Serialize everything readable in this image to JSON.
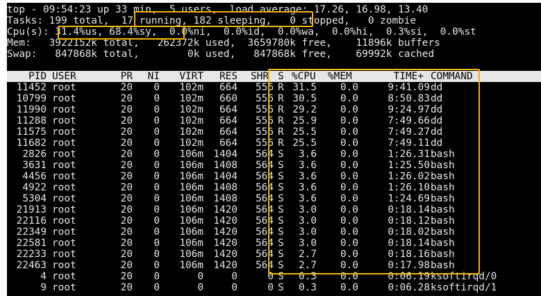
{
  "summary": {
    "uptime_line": "top - 09:54:23 up 33 min,  5 users,  load average: 17.26, 16.98, 13.40",
    "tasks_line": "Tasks: 199 total,  17 running, 182 sleeping,   0 stopped,   0 zombie",
    "cpu_line": "Cpu(s): 31.4%us, 68.4%sy,  0.0%ni,  0.0%id,  0.0%wa,  0.0%hi,  0.3%si,  0.0%st",
    "mem_line": "Mem:   3922152k total,   262372k used,  3659780k free,    11896k buffers",
    "swap_line": "Swap:   847868k total,        0k used,   847868k free,    69992k cached"
  },
  "columns": {
    "pid": "PID",
    "user": "USER",
    "pr": "PR",
    "ni": "NI",
    "virt": "VIRT",
    "res": "RES",
    "shr": "SHR",
    "s": "S",
    "cpu": "%CPU",
    "mem": "%MEM",
    "time": "TIME+",
    "command": "COMMAND"
  },
  "processes": [
    {
      "pid": "11452",
      "user": "root",
      "pr": "20",
      "ni": "0",
      "virt": "102m",
      "res": "664",
      "shr": "556",
      "s": "R",
      "cpu": "31.5",
      "mem": "0.0",
      "time": "9:41.09",
      "command": "dd"
    },
    {
      "pid": "10799",
      "user": "root",
      "pr": "20",
      "ni": "0",
      "virt": "102m",
      "res": "660",
      "shr": "556",
      "s": "R",
      "cpu": "30.5",
      "mem": "0.0",
      "time": "8:50.83",
      "command": "dd"
    },
    {
      "pid": "11990",
      "user": "root",
      "pr": "20",
      "ni": "0",
      "virt": "102m",
      "res": "664",
      "shr": "556",
      "s": "R",
      "cpu": "29.2",
      "mem": "0.0",
      "time": "9:24.97",
      "command": "dd"
    },
    {
      "pid": "11288",
      "user": "root",
      "pr": "20",
      "ni": "0",
      "virt": "102m",
      "res": "664",
      "shr": "556",
      "s": "R",
      "cpu": "25.9",
      "mem": "0.0",
      "time": "7:49.66",
      "command": "dd"
    },
    {
      "pid": "11575",
      "user": "root",
      "pr": "20",
      "ni": "0",
      "virt": "102m",
      "res": "664",
      "shr": "556",
      "s": "R",
      "cpu": "25.5",
      "mem": "0.0",
      "time": "7:49.27",
      "command": "dd"
    },
    {
      "pid": "11682",
      "user": "root",
      "pr": "20",
      "ni": "0",
      "virt": "102m",
      "res": "664",
      "shr": "556",
      "s": "R",
      "cpu": "25.5",
      "mem": "0.0",
      "time": "7:49.11",
      "command": "dd"
    },
    {
      "pid": "2826",
      "user": "root",
      "pr": "20",
      "ni": "0",
      "virt": "106m",
      "res": "1404",
      "shr": "564",
      "s": "S",
      "cpu": "3.6",
      "mem": "0.0",
      "time": "1:26.31",
      "command": "bash"
    },
    {
      "pid": "3631",
      "user": "root",
      "pr": "20",
      "ni": "0",
      "virt": "106m",
      "res": "1408",
      "shr": "564",
      "s": "S",
      "cpu": "3.6",
      "mem": "0.0",
      "time": "1:25.50",
      "command": "bash"
    },
    {
      "pid": "4456",
      "user": "root",
      "pr": "20",
      "ni": "0",
      "virt": "106m",
      "res": "1404",
      "shr": "564",
      "s": "S",
      "cpu": "3.6",
      "mem": "0.0",
      "time": "1:26.02",
      "command": "bash"
    },
    {
      "pid": "4922",
      "user": "root",
      "pr": "20",
      "ni": "0",
      "virt": "106m",
      "res": "1408",
      "shr": "564",
      "s": "S",
      "cpu": "3.6",
      "mem": "0.0",
      "time": "1:26.10",
      "command": "bash"
    },
    {
      "pid": "5304",
      "user": "root",
      "pr": "20",
      "ni": "0",
      "virt": "106m",
      "res": "1408",
      "shr": "564",
      "s": "S",
      "cpu": "3.6",
      "mem": "0.0",
      "time": "1:24.69",
      "command": "bash"
    },
    {
      "pid": "21913",
      "user": "root",
      "pr": "20",
      "ni": "0",
      "virt": "106m",
      "res": "1420",
      "shr": "564",
      "s": "S",
      "cpu": "3.0",
      "mem": "0.0",
      "time": "0:18.14",
      "command": "bash"
    },
    {
      "pid": "22116",
      "user": "root",
      "pr": "20",
      "ni": "0",
      "virt": "106m",
      "res": "1420",
      "shr": "564",
      "s": "S",
      "cpu": "3.0",
      "mem": "0.0",
      "time": "0:18.12",
      "command": "bash"
    },
    {
      "pid": "22349",
      "user": "root",
      "pr": "20",
      "ni": "0",
      "virt": "106m",
      "res": "1420",
      "shr": "564",
      "s": "S",
      "cpu": "3.0",
      "mem": "0.0",
      "time": "0:18.02",
      "command": "bash"
    },
    {
      "pid": "22581",
      "user": "root",
      "pr": "20",
      "ni": "0",
      "virt": "106m",
      "res": "1420",
      "shr": "564",
      "s": "S",
      "cpu": "3.0",
      "mem": "0.0",
      "time": "0:18.14",
      "command": "bash"
    },
    {
      "pid": "22233",
      "user": "root",
      "pr": "20",
      "ni": "0",
      "virt": "106m",
      "res": "1420",
      "shr": "564",
      "s": "S",
      "cpu": "2.7",
      "mem": "0.0",
      "time": "0:18.16",
      "command": "bash"
    },
    {
      "pid": "22463",
      "user": "root",
      "pr": "20",
      "ni": "0",
      "virt": "106m",
      "res": "1420",
      "shr": "564",
      "s": "S",
      "cpu": "2.7",
      "mem": "0.0",
      "time": "0:17.98",
      "command": "bash"
    },
    {
      "pid": "4",
      "user": "root",
      "pr": "20",
      "ni": "0",
      "virt": "0",
      "res": "0",
      "shr": "0",
      "s": "S",
      "cpu": "0.3",
      "mem": "0.0",
      "time": "0:06.19",
      "command": "ksoftirqd/0"
    },
    {
      "pid": "9",
      "user": "root",
      "pr": "20",
      "ni": "0",
      "virt": "0",
      "res": "0",
      "shr": "0",
      "s": "S",
      "cpu": "0.3",
      "mem": "0.0",
      "time": "0:06.28",
      "command": "ksoftirqd/1"
    }
  ],
  "colors": {
    "terminal_bg": "#000000",
    "text": "#e6e6e6",
    "header_bar": "#e6e6e6",
    "highlight": "#f5b400"
  }
}
